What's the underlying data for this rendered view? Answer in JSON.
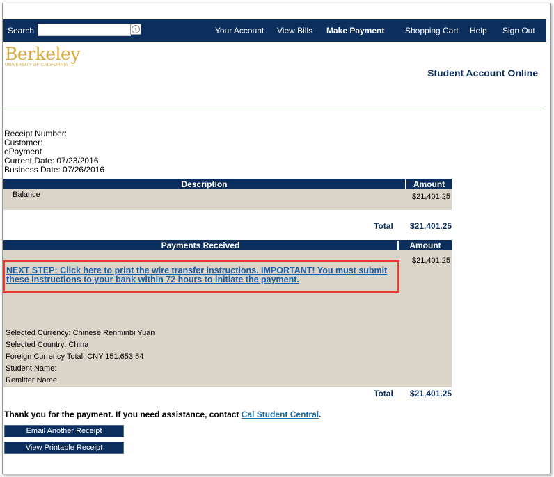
{
  "nav": {
    "search_label": "Search",
    "search_value": "",
    "links": [
      "Your Account",
      "View Bills",
      "Make Payment",
      "Shopping Cart",
      "Help",
      "Sign Out"
    ]
  },
  "logo": {
    "word": "Berkeley",
    "sub": "UNIVERSITY OF CALIFORNIA"
  },
  "page_title": "Student Account Online",
  "receipt": {
    "receipt_number": "Receipt Number:",
    "customer": "Customer:",
    "epayment": "ePayment",
    "current_date": "Current Date: 07/23/2016",
    "business_date": "Business Date: 07/26/2016"
  },
  "desc_table": {
    "col_description": "Description",
    "col_amount": "Amount",
    "row_label": "Balance",
    "row_amount": "$21,401.25",
    "total_label": "Total",
    "total_value": "$21,401.25"
  },
  "payments_table": {
    "col_payments": "Payments Received",
    "col_amount": "Amount",
    "row_amount": "$21,401.25",
    "next_step_link": "NEXT STEP:  Click here to print the wire transfer instructions.  IMPORTANT!  You must submit these instructions to your bank within 72 hours to initiate the payment.",
    "selected_currency": "Selected Currency: Chinese Renminbi Yuan",
    "selected_country": "Selected Country: China",
    "foreign_total": "Foreign Currency Total: CNY 151,653.54",
    "student_name": "Student Name:",
    "remitter_name": "Remitter Name",
    "total_label": "Total",
    "total_value": "$21,401.25"
  },
  "thanks": {
    "text": "Thank you for the payment. If you need assistance, contact ",
    "link": "Cal Student Central",
    "end": "."
  },
  "buttons": {
    "email_receipt": "Email Another Receipt",
    "view_printable": "View Printable Receipt"
  }
}
